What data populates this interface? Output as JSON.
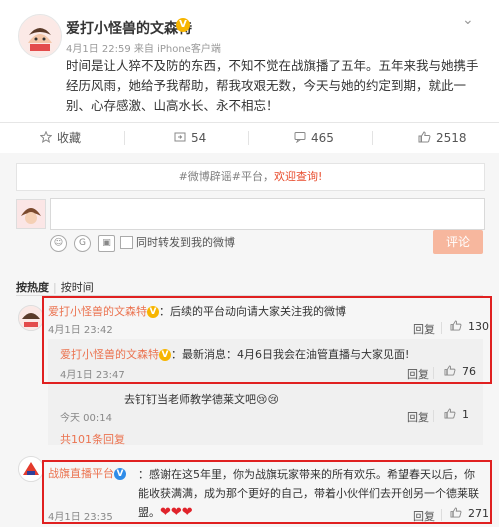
{
  "post": {
    "username": "爱打小怪兽的文森特",
    "verified_badge": "V",
    "meta": "4月1日 22:59 来自 iPhone客户端",
    "text": "时间是让人猝不及防的东西，不知不觉在战旗播了五年。五年来我与她携手经历风雨，她给予我帮助，帮我攻艰无数，今天与她的约定到期，就此一别、心存感激、山高水长、永不相忘！",
    "menu_icon": "chevron-down-icon"
  },
  "actions": {
    "favorite": "收藏",
    "repost_count": "54",
    "comment_count": "465",
    "like_count": "2518"
  },
  "composer": {
    "topic_prefix": "#微博辟谣#平台，",
    "topic_link": "欢迎查询!",
    "repost_checkbox_label": "同时转发到我的微博",
    "submit_label": "评论",
    "emoji_icons": [
      "smiley-icon",
      "gif-icon",
      "image-icon",
      "topic-icon"
    ]
  },
  "sort": {
    "hot": "按热度",
    "time": "按时间"
  },
  "comments": [
    {
      "name": "爱打小怪兽的文森特",
      "badge": "V",
      "text": "：后续的平台动向请大家关注我的微博",
      "time": "4月1日 23:42",
      "reply": "回复",
      "likes": "130",
      "sub_replies": [
        {
          "name": "爱打小怪兽的文森特",
          "badge": "V",
          "text": "：最新消息：4月6日我会在油管直播与大家见面!",
          "time": "4月1日 23:47",
          "reply": "回复",
          "likes": "76"
        },
        {
          "name": "",
          "text": "去钉钉当老师教学德莱文吧",
          "emoji": "😢😢",
          "time": "今天 00:14",
          "reply": "回复",
          "likes": "1"
        }
      ],
      "more": "共101条回复"
    },
    {
      "name": "战旗直播平台",
      "badge": "V",
      "text": "：感谢在这5年里，你为战旗玩家带来的所有欢乐。希望春天以后，你能收获满满，成为那个更好的自己，带着小伙伴们去开创另一个德莱联盟。",
      "hearts": "❤❤❤",
      "time": "4月1日 23:35",
      "reply": "回复",
      "likes": "271"
    }
  ],
  "colors": {
    "accent": "#eb7350",
    "highlight_box": "#e02020",
    "badge_yellow": "#f7b500",
    "badge_blue": "#2f8ce8"
  }
}
